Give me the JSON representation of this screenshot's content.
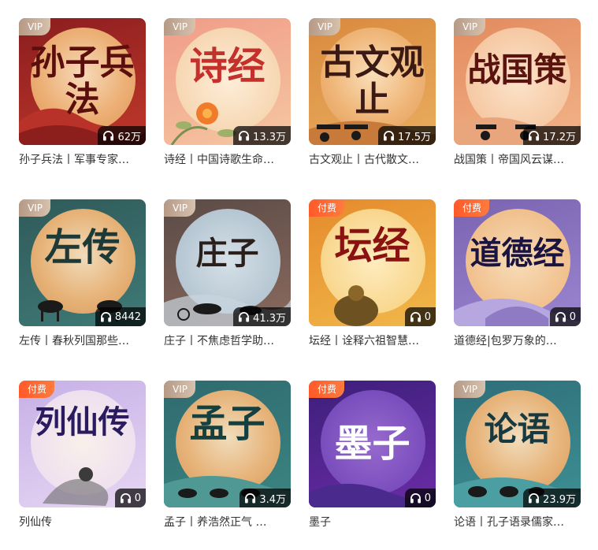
{
  "items": [
    {
      "badge": "VIP",
      "cover_text": "孙子兵法",
      "listens": "62万",
      "title": "孙子兵法丨军事专家…"
    },
    {
      "badge": "VIP",
      "cover_text": "诗经",
      "listens": "13.3万",
      "title": "诗经丨中国诗歌生命…"
    },
    {
      "badge": "VIP",
      "cover_text": "古文观止",
      "listens": "17.5万",
      "title": "古文观止丨古代散文…"
    },
    {
      "badge": "VIP",
      "cover_text": "战国策",
      "listens": "17.2万",
      "title": "战国策丨帝国风云谋…"
    },
    {
      "badge": "VIP",
      "cover_text": "左传",
      "listens": "8442",
      "title": "左传丨春秋列国那些…"
    },
    {
      "badge": "VIP",
      "cover_text": "庄子",
      "listens": "41.3万",
      "title": "庄子丨不焦虑哲学助…"
    },
    {
      "badge": "付费",
      "cover_text": "坛经",
      "listens": "0",
      "title": "坛经丨诠释六祖智慧…"
    },
    {
      "badge": "付费",
      "cover_text": "道德经",
      "listens": "0",
      "title": "道德经|包罗万象的…"
    },
    {
      "badge": "付费",
      "cover_text": "列仙传",
      "listens": "0",
      "title": "列仙传"
    },
    {
      "badge": "VIP",
      "cover_text": "孟子",
      "listens": "3.4万",
      "title": "孟子丨养浩然正气 …"
    },
    {
      "badge": "付费",
      "cover_text": "墨子",
      "listens": "0",
      "title": "墨子"
    },
    {
      "badge": "VIP",
      "cover_text": "论语",
      "listens": "23.9万",
      "title": "论语丨孔子语录儒家…"
    }
  ],
  "icons": {
    "listen_icon": "headphones-icon"
  },
  "colors": {
    "vip_badge": "#c4ac98",
    "paid_badge": "#ff5a2a",
    "count_bg": "#000000"
  }
}
